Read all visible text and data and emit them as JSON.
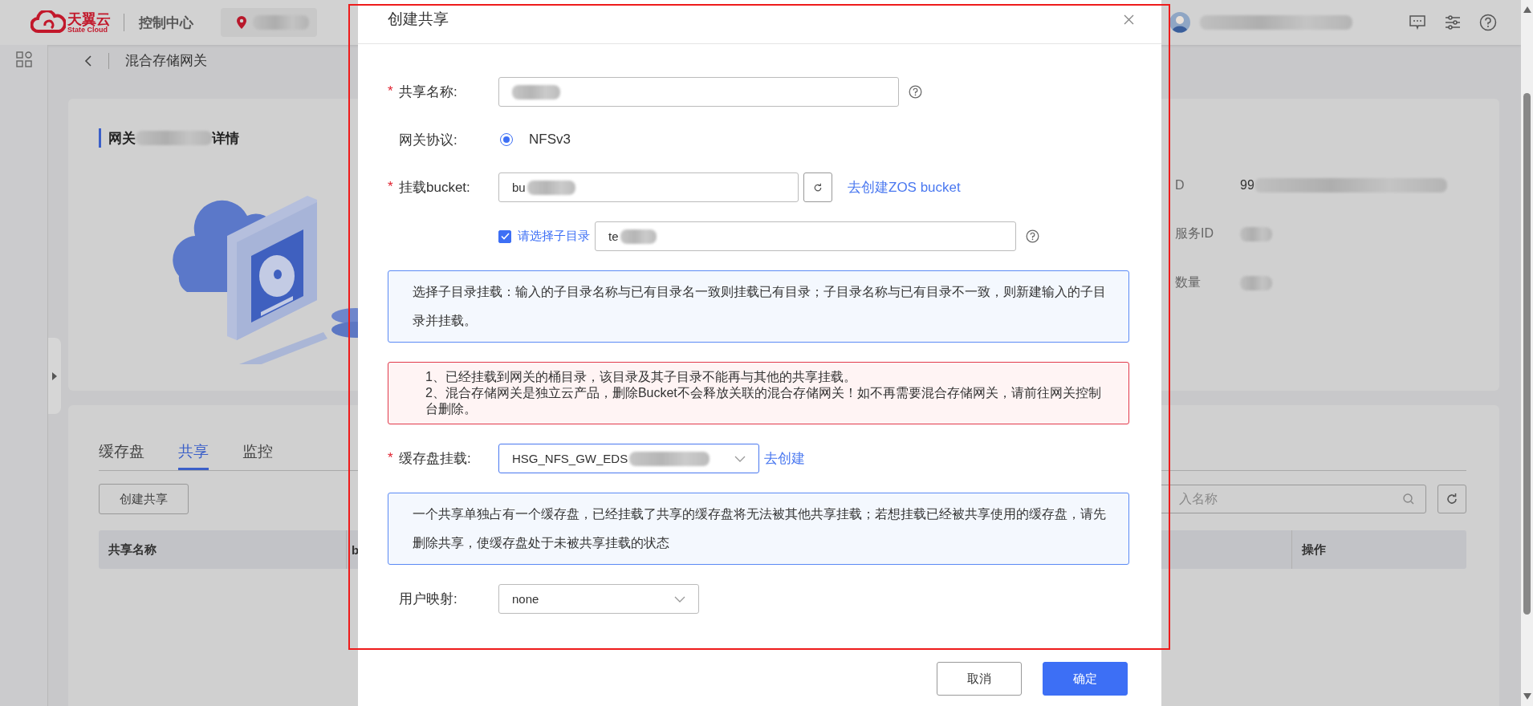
{
  "header": {
    "logo_title": "天翼云",
    "logo_subtitle": "State Cloud",
    "console": "控制中心"
  },
  "breadcrumb": {
    "title": "混合存储网关"
  },
  "detail": {
    "title_start": "网关",
    "title_end": "详情",
    "fields": [
      {
        "label": "D",
        "value": "99"
      },
      {
        "label": "服务ID"
      },
      {
        "label": "数量"
      }
    ]
  },
  "tabs": [
    {
      "label": "缓存盘",
      "selected": false
    },
    {
      "label": "共享",
      "selected": true
    },
    {
      "label": "监控",
      "selected": false
    }
  ],
  "create_button": "创建共享",
  "search": {
    "placeholder": "入名称"
  },
  "table": {
    "columns": [
      "共享名称",
      "b",
      "操作"
    ]
  },
  "dialog": {
    "title": "创建共享",
    "items": [
      {
        "kind": "text",
        "required_mark": "*",
        "label": "共享名称:",
        "help": true
      },
      {
        "kind": "radio",
        "label": "网关协议:",
        "options": [
          {
            "label": "NFSv3",
            "selected": true
          }
        ]
      },
      {
        "kind": "bucket",
        "required_mark": "*",
        "label": "挂载bucket:",
        "value": "bu",
        "link": "去创建ZOS bucket"
      },
      {
        "kind": "subdir",
        "checked": true,
        "label": "请选择子目录",
        "value": "te",
        "help": true
      },
      {
        "kind": "info",
        "lines": [
          "选择子目录挂载：输入的子目录名称与已有目录名一致则挂载已有目录；子目录名称与已有目录不一致，则新建输入的子目录并挂载。"
        ]
      },
      {
        "kind": "warning",
        "lines": [
          "1、已经挂载到网关的桶目录，该目录及其子目录不能再与其他的共享挂载。",
          "2、混合存储网关是独立云产品，删除Bucket不会释放关联的混合存储网关！如不再需要混合存储网关，请前往网关控制台删除。"
        ]
      },
      {
        "kind": "select",
        "required_mark": "*",
        "label": "缓存盘挂载:",
        "value": "HSG_NFS_GW_EDS",
        "link": "去创建",
        "masked": true
      },
      {
        "kind": "info",
        "lines": [
          "一个共享单独占有一个缓存盘，已经挂载了共享的缓存盘将无法被其他共享挂载；若想挂载已经被共享使用的缓存盘，请先删除共享，使缓存盘处于未被共享挂载的状态"
        ]
      },
      {
        "kind": "select",
        "label": "用户映射:",
        "value": "none",
        "masked": false
      }
    ],
    "buttons": [
      {
        "label": "取消",
        "primary": false
      },
      {
        "label": "确定",
        "primary": true
      }
    ]
  }
}
